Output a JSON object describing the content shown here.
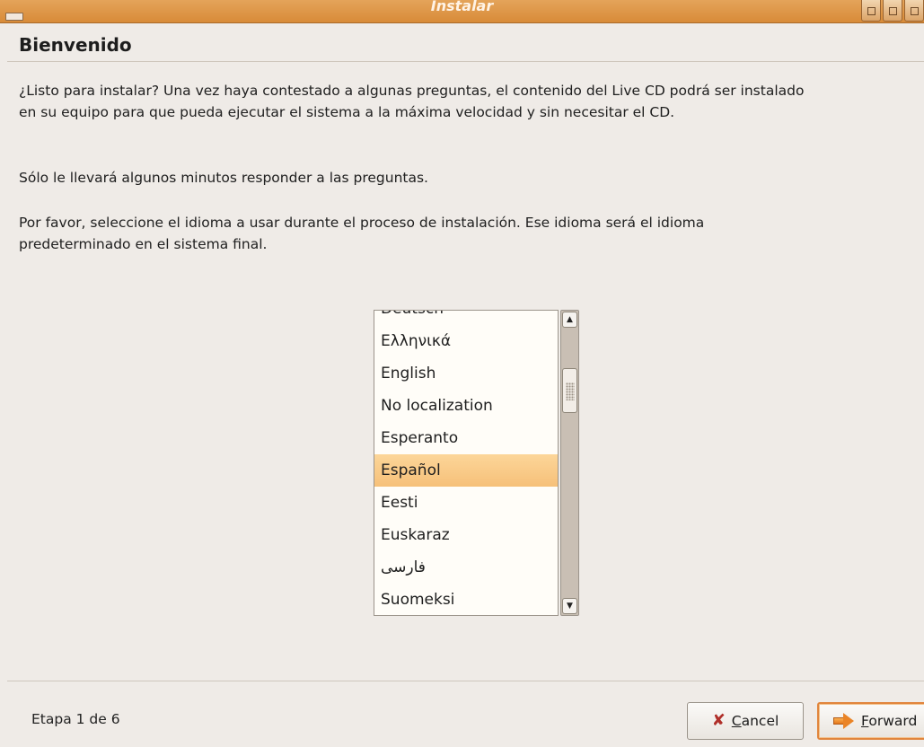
{
  "window": {
    "title": "Instalar"
  },
  "page": {
    "heading": "Bienvenido",
    "paragraph1": "¿Listo para instalar? Una vez haya contestado a algunas preguntas, el contenido del Live CD podrá ser instalado en su equipo para que pueda ejecutar el sistema a la máxima velocidad y sin necesitar el CD.",
    "paragraph2": "Sólo le llevará algunos minutos responder a las preguntas.",
    "paragraph3": "Por favor, seleccione el idioma a usar durante el proceso de instalación. Ese idioma será el idioma predeterminado en el sistema final."
  },
  "language_list": {
    "items": [
      "Deutsch",
      "Ελληνικά",
      "English",
      "No localization",
      "Esperanto",
      "Español",
      "Eesti",
      "Euskaraz",
      "فارسی",
      "Suomeksi"
    ],
    "selected": "Español"
  },
  "footer": {
    "stage": "Etapa 1 de 6",
    "cancel_mnemonic": "C",
    "cancel_rest": "ancel",
    "forward_mnemonic": "F",
    "forward_rest": "orward"
  },
  "colors": {
    "titlebar": "#dd9140",
    "selection": "#f8c983",
    "background": "#efebe7"
  },
  "icons": {
    "cancel": "cancel-x-icon",
    "forward": "forward-arrow-icon",
    "scroll_up": "scroll-up-arrow-icon",
    "scroll_down": "scroll-down-arrow-icon"
  }
}
